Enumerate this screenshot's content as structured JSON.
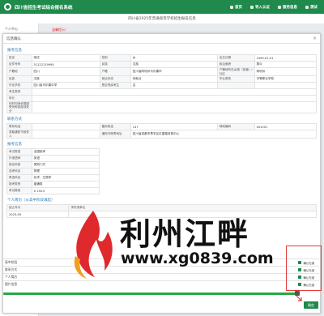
{
  "app": {
    "title": "四川省招生考试综合报名系统",
    "nav": [
      "首页",
      "导入认证",
      "服务信息",
      "测试"
    ]
  },
  "background": {
    "page_title": "四川省2025年普通高等学校招生报名信息",
    "sidebar": [
      "个人中心",
      "考生报名"
    ],
    "notice": "温馨提示！"
  },
  "modal": {
    "title": "信息确认",
    "close": "×",
    "sections": {
      "basic": "报考信息",
      "contact": "联系方式",
      "exam": "报考信息",
      "resume": "个人简历（从高中阶段填起）"
    },
    "basic_rows": [
      [
        "姓名",
        "测试",
        "性别",
        "女",
        "出生日期",
        "1999-01-01"
      ],
      [
        "证件号码",
        "51122119990",
        "民族",
        "汉族",
        "政治面貌",
        "群众"
      ],
      [
        "户籍地",
        "四川",
        "户籍",
        "四川省阿坝州马尔康市",
        "户籍地所在乡镇（街道）/社区",
        "阿坝州"
      ],
      [
        "民族",
        "汉族",
        "就业状态",
        "待就业",
        "毕业类别",
        "中等职业学校"
      ],
      [
        "毕业学校",
        "四川省马尔康中学",
        "是否残疾考生",
        "否",
        "",
        ""
      ],
      [
        "考生类别",
        "",
        "",
        "",
        "",
        ""
      ],
      [
        "特长",
        "",
        "",
        "",
        "",
        ""
      ],
      [
        "何时何地何原因受何种奖励或处分",
        "",
        "",
        "",
        "",
        ""
      ]
    ],
    "contact_rows": [
      [
        "联系电话",
        "",
        "备用电话",
        "137",
        "邮政编码",
        "001001"
      ],
      [
        "录取通知书收件人",
        "",
        "通知书邮寄地址",
        "四川省成都市青羊区红星路体育中心",
        "",
        ""
      ]
    ],
    "exam_rows": [
      [
        "考试类型",
        "全国统考"
      ],
      [
        "外语语种",
        "英语"
      ],
      [
        "报名科类",
        "类别门式"
      ],
      [
        "选考科目",
        "物理"
      ],
      [
        "再选科目",
        "化学、生物学"
      ],
      [
        "报考类别",
        "普通类"
      ],
      [
        "考试费用",
        "¥ 150.0"
      ]
    ],
    "resume_header": [
      "起止年月",
      "学校或单位"
    ],
    "resume_rows": [
      [
        "2023-09",
        ""
      ]
    ],
    "collapsed_rows": [
      {
        "label": "高中阶段",
        "action": "确认无误"
      },
      {
        "label": "联系方式",
        "action": "确认无误"
      },
      {
        "label": "个人简历",
        "action": "确认无误"
      },
      {
        "label": "图片信息",
        "action": "确认无误"
      }
    ],
    "confirm_button": "确定"
  },
  "watermark": {
    "name": "利州江畔",
    "url": "www.xg0839.com"
  },
  "colors": {
    "brand": "#1f8a4c",
    "highlight": "#e23b3b",
    "section": "#2a7ab8"
  }
}
